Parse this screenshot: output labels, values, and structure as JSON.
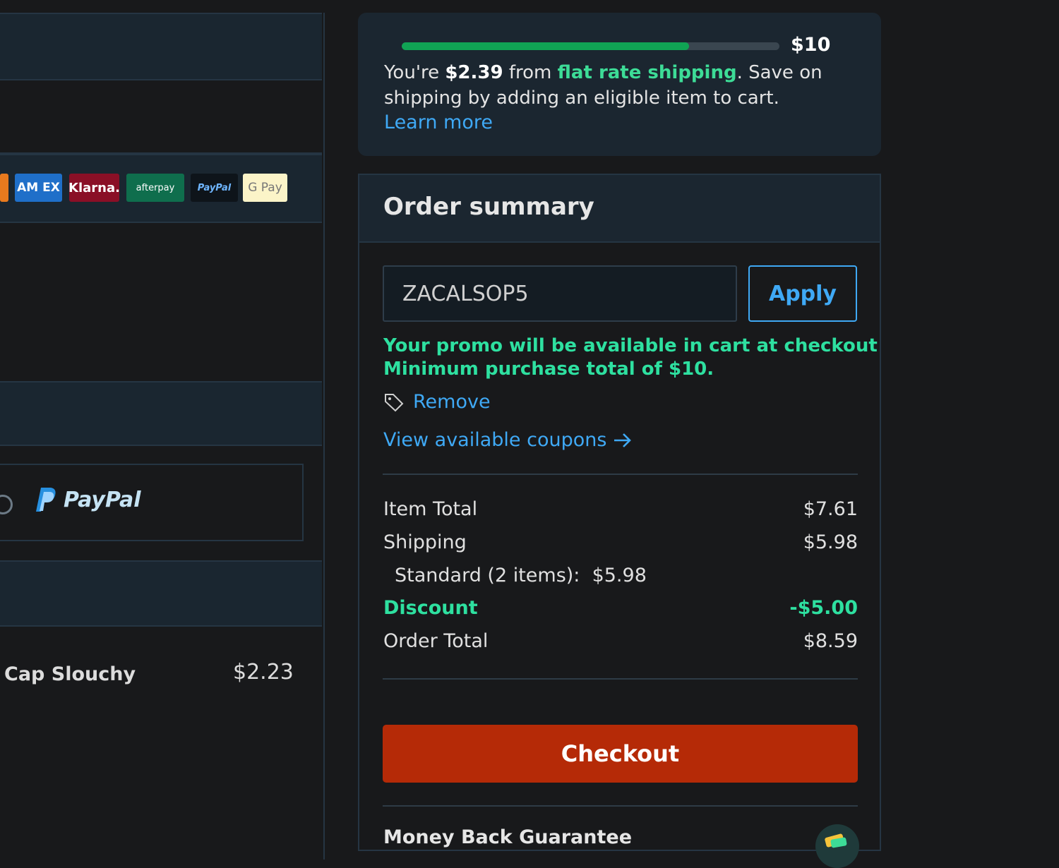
{
  "payment_methods": [
    {
      "name": "amex",
      "label": "AM EX",
      "bg": "#1f6fc9",
      "fg": "#ffffff"
    },
    {
      "name": "klarna",
      "label": "Klarna.",
      "bg": "#8a0f26",
      "fg": "#ffffff"
    },
    {
      "name": "afterpay",
      "label": "afterpay",
      "bg": "#0f6e4d",
      "fg": "#ffffff"
    },
    {
      "name": "paypal-small",
      "label": "PayPal",
      "bg": "#0e141a",
      "fg": "#6fb6ff"
    },
    {
      "name": "gpay",
      "label": "G Pay",
      "bg": "#fbf4c8",
      "fg": "#777777"
    }
  ],
  "paypal_option": {
    "label": "PayPal"
  },
  "cart_item": {
    "name": "Cap Slouchy",
    "price": "$2.23"
  },
  "shipping_banner": {
    "threshold": "$10",
    "progress_fraction": 0.76,
    "prefix": "You're ",
    "amount_away": "$2.39",
    "middle": " from ",
    "flat_rate": "flat rate shipping",
    "suffix": ". Save on shipping by adding an eligible item to cart.",
    "learn_more": "Learn more"
  },
  "order_summary": {
    "title": "Order summary",
    "promo_code": "ZACALSOP5",
    "apply_label": "Apply",
    "promo_line1": "Your promo will be available in cart at checkout",
    "promo_line2": "Minimum purchase total of $10.",
    "remove_label": "Remove",
    "view_coupons_label": "View available coupons",
    "item_total_label": "Item Total",
    "item_total_value": "$7.61",
    "shipping_label": "Shipping",
    "shipping_value": "$5.98",
    "standard_label": "Standard (2 items):",
    "standard_value": "$5.98",
    "discount_label": "Discount",
    "discount_value": "-$5.00",
    "order_total_label": "Order Total",
    "order_total_value": "$8.59",
    "checkout_label": "Checkout",
    "guarantee_label": "Money Back Guarantee"
  },
  "colors": {
    "background": "#18191b",
    "panel": "#1b2630",
    "accent_blue": "#3fa9f5",
    "accent_green": "#2ee0a0",
    "checkout_orange": "#b52a07"
  }
}
